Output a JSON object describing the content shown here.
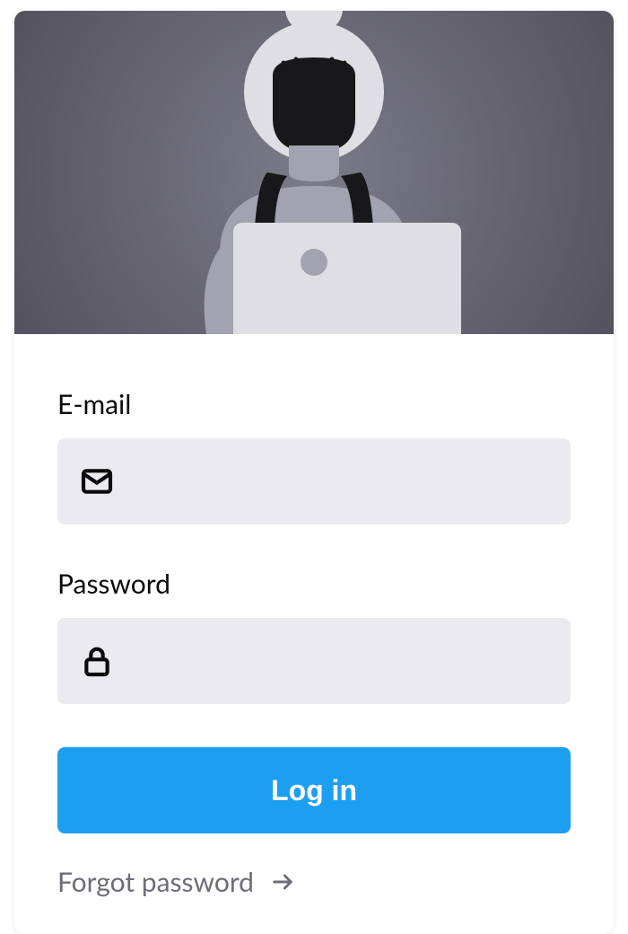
{
  "form": {
    "email": {
      "label": "E-mail",
      "value": "",
      "icon": "mail-icon"
    },
    "password": {
      "label": "Password",
      "value": "",
      "icon": "lock-icon"
    },
    "submit_label": "Log in",
    "forgot_label": "Forgot password"
  },
  "colors": {
    "primary": "#1c9ff0",
    "input_bg": "#ebebef",
    "text": "#0b0b0b",
    "muted": "#6d6d7a"
  }
}
